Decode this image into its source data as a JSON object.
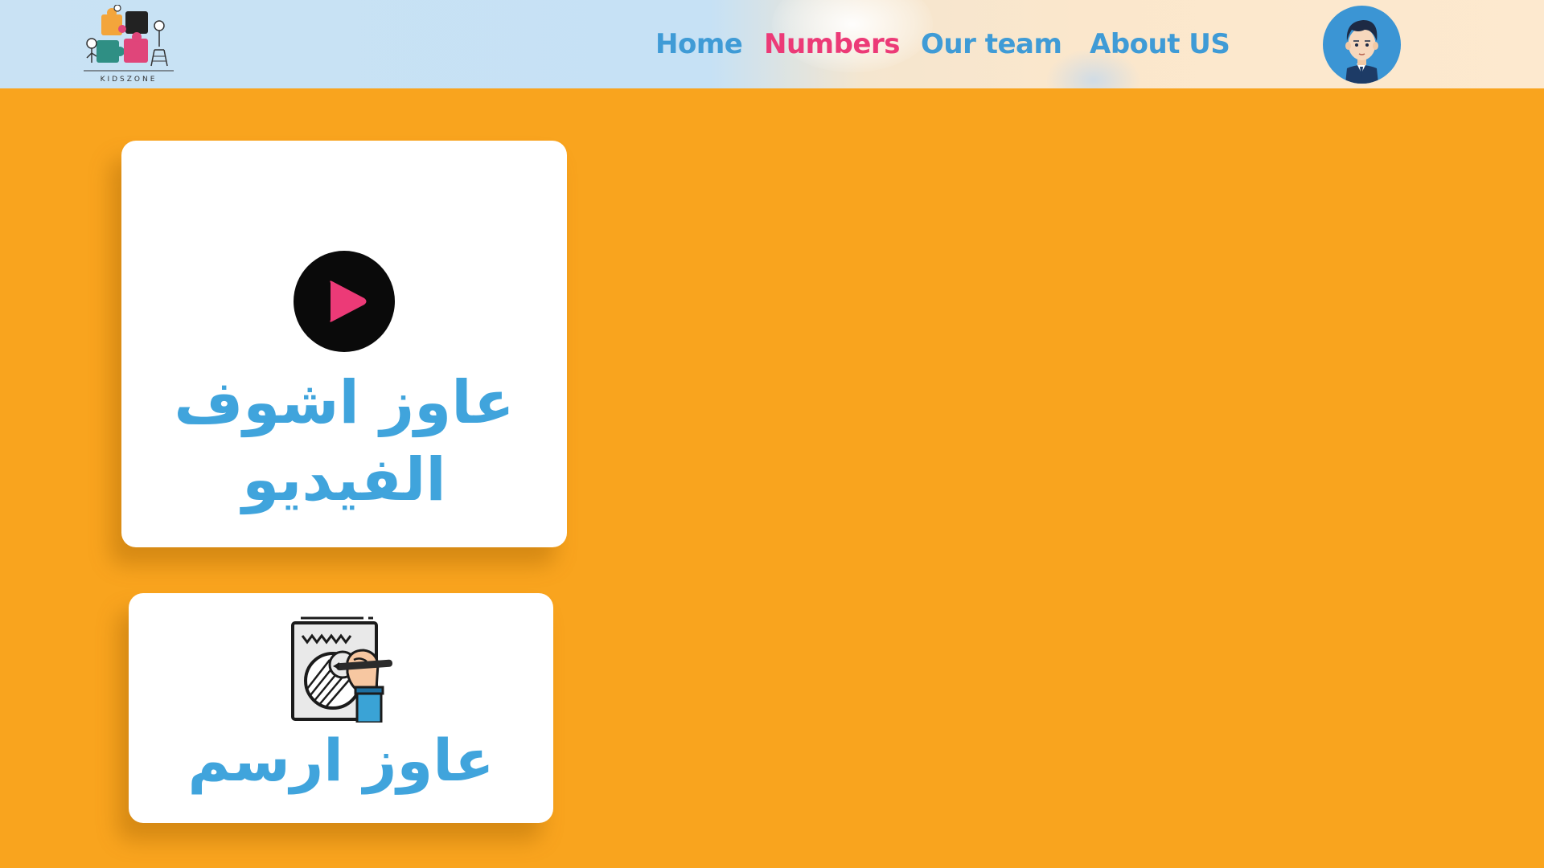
{
  "app": {
    "logo_text": "KIDSZONE"
  },
  "nav": {
    "items": [
      {
        "label": "Home",
        "active": false
      },
      {
        "label": "Numbers",
        "active": true
      },
      {
        "label": "Our team",
        "active": false
      },
      {
        "label": "About US",
        "active": false
      }
    ]
  },
  "header": {
    "avatar_icon": "boy-avatar-icon"
  },
  "cards": [
    {
      "title": "عاوز اشوف الفيديو",
      "icon": "play-icon"
    },
    {
      "title": "عاوز ارسم",
      "icon": "drawing-icon"
    }
  ],
  "colors": {
    "background": "#f9a41e",
    "nav_link": "#3f9bd6",
    "nav_active": "#ec3a77",
    "card_title": "#40a4dc",
    "card_bg": "#ffffff",
    "avatar_bg": "#3b95d4"
  }
}
